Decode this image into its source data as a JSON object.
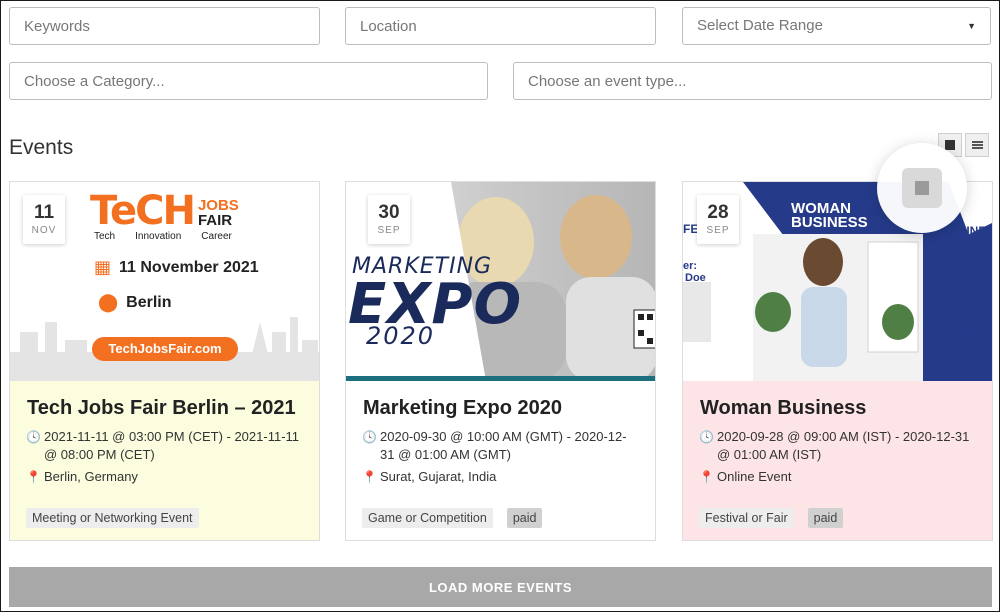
{
  "filters": {
    "keywords_placeholder": "Keywords",
    "location_placeholder": "Location",
    "date_range": "Select Date Range",
    "category_placeholder": "Choose a Category...",
    "event_type_placeholder": "Choose an event type..."
  },
  "section": {
    "title": "Events"
  },
  "events": [
    {
      "day": "11",
      "month": "NOV",
      "title": "Tech Jobs Fair Berlin – 2021",
      "datetime": "2021-11-11 @ 03:00 PM (CET) - 2021-11-11 @ 08:00 PM (CET)",
      "location": "Berlin, Germany",
      "tags": [
        "Meeting or Networking Event"
      ],
      "price_tag": "",
      "banner": {
        "logo_big": "TeCH",
        "logo_jobs": "JOBS",
        "logo_fair": "FAIR",
        "sub": [
          "Tech",
          "Innovation",
          "Career"
        ],
        "date_line": "11 November 2021",
        "city_line": "Berlin",
        "button": "TechJobsFair.com"
      }
    },
    {
      "day": "30",
      "month": "SEP",
      "title": "Marketing Expo 2020",
      "datetime": "2020-09-30 @ 10:00 AM (GMT) - 2020-12-31 @ 01:00 AM (GMT)",
      "location": "Surat, Gujarat, India",
      "tags": [
        "Game or Competition"
      ],
      "price_tag": "paid",
      "banner": {
        "line1": "MARKETING",
        "line2": "EXPO",
        "line3": "2020"
      }
    },
    {
      "day": "28",
      "month": "SEP",
      "title": "Woman Business",
      "datetime": "2020-09-28 @ 09:00 AM (IST) - 2020-12-31 @ 01:00 AM (IST)",
      "location": "Online Event",
      "tags": [
        "Festival or Fair"
      ],
      "price_tag": "paid",
      "banner": {
        "line1": "WOMAN",
        "line2": "BUSINESS",
        "side": "BUSINESS",
        "left_partial": "FE",
        "speaker": "er:",
        "speaker_name": "Doe"
      }
    }
  ],
  "load_more": "LOAD MORE EVENTS",
  "colors": {
    "card1_body": "#fcfcdf",
    "card3_body": "#fde4e7",
    "brand_orange": "#f37021",
    "navy": "#253b8a",
    "teal_bar": "#1b6f7e",
    "load_more_bg": "#a8a8a8"
  },
  "icons": [
    "clock-icon",
    "map-pin-icon",
    "calendar-icon",
    "grid-view-icon",
    "list-view-icon",
    "caret-down-icon"
  ]
}
